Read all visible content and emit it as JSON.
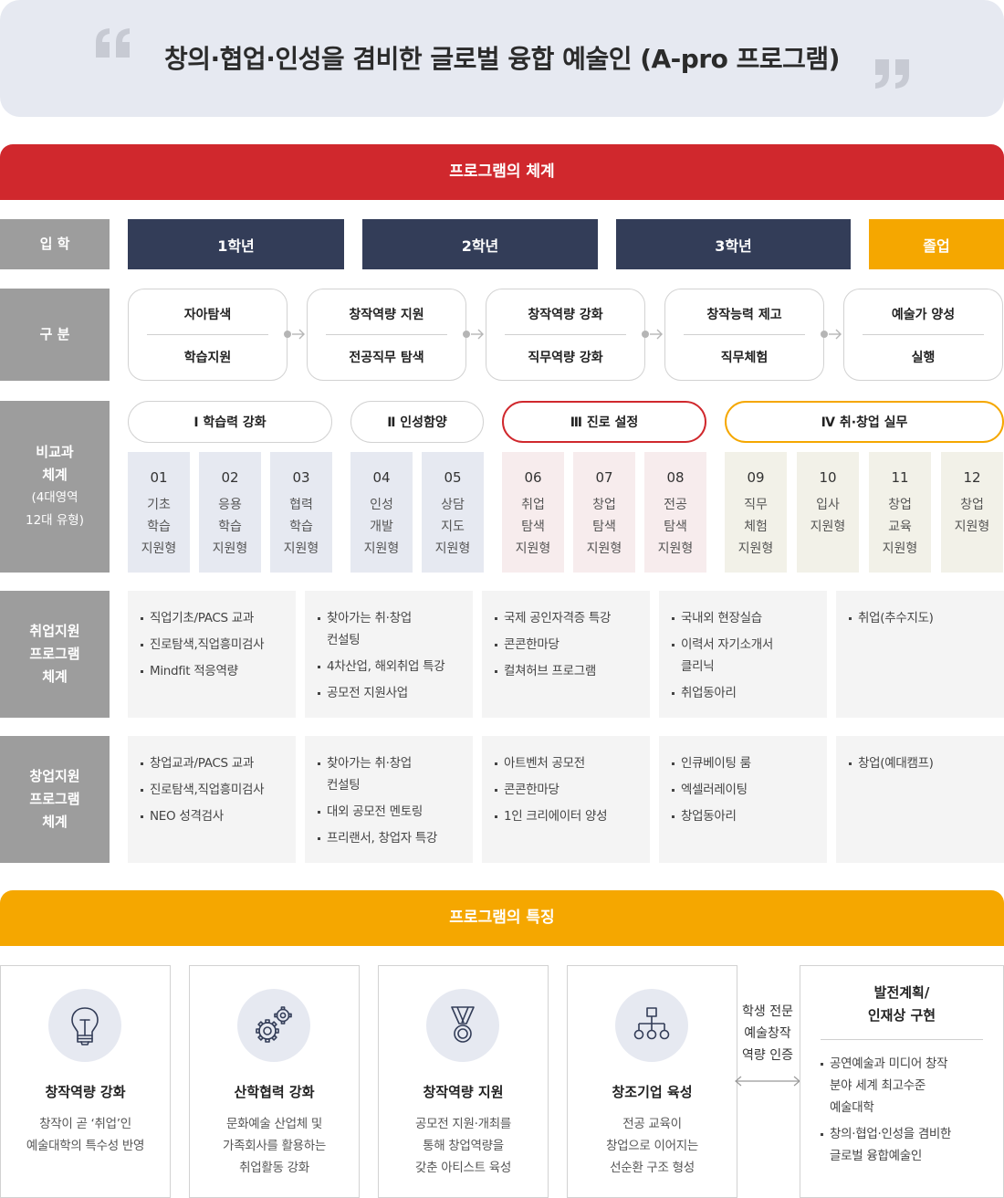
{
  "title": "창의·협업·인성을 겸비한 글로벌 융합 예술인 (A-pro 프로그램)",
  "section_system": "프로그램의 체계",
  "section_features": "프로그램의 특징",
  "row_labels": {
    "admission": "입  학",
    "category": "구  분",
    "non_curricular": "비교과\n체계",
    "non_curricular_sub": "(4대영역\n12대 유형)",
    "employment": "취업지원\n프로그램\n체계",
    "startup": "창업지원\n프로그램\n체계"
  },
  "years": [
    "1학년",
    "2학년",
    "3학년",
    "졸업"
  ],
  "stages": [
    {
      "top": "자아탐색",
      "bottom": "학습지원"
    },
    {
      "top": "창작역량 지원",
      "bottom": "전공직무 탐색"
    },
    {
      "top": "창작역량 강화",
      "bottom": "직무역량 강화"
    },
    {
      "top": "창작능력 제고",
      "bottom": "직무체험"
    },
    {
      "top": "예술가 양성",
      "bottom": "실행"
    }
  ],
  "areas": [
    "Ⅰ  학습력 강화",
    "Ⅱ 인성함양",
    "Ⅲ 진로 설정",
    "Ⅳ 취·창업 실무"
  ],
  "types": [
    {
      "num": "01",
      "name": "기초\n학습\n지원형"
    },
    {
      "num": "02",
      "name": "응용\n학습\n지원형"
    },
    {
      "num": "03",
      "name": "협력\n학습\n지원형"
    },
    {
      "num": "04",
      "name": "인성\n개발\n지원형"
    },
    {
      "num": "05",
      "name": "상담\n지도\n지원형"
    },
    {
      "num": "06",
      "name": "취업\n탐색\n지원형"
    },
    {
      "num": "07",
      "name": "창업\n탐색\n지원형"
    },
    {
      "num": "08",
      "name": "전공\n탐색\n지원형"
    },
    {
      "num": "09",
      "name": "직무\n체험\n지원형"
    },
    {
      "num": "10",
      "name": "입사\n지원형"
    },
    {
      "num": "11",
      "name": "창업\n교육\n지원형"
    },
    {
      "num": "12",
      "name": "창업\n지원형"
    }
  ],
  "employment": [
    [
      "직업기초/PACS 교과",
      "진로탐색,직업흥미검사",
      "Mindfit 적응역량"
    ],
    [
      "찾아가는 취·창업\n컨설팅",
      "4차산업, 해외취업 특강",
      "공모전 지원사업"
    ],
    [
      "국제 공인자격증 특강",
      "콘콘한마당",
      "컬쳐허브 프로그램"
    ],
    [
      "국내외 현장실습",
      "이력서 자기소개서\n클리닉",
      "취업동아리"
    ],
    [
      "취업(추수지도)"
    ]
  ],
  "startup": [
    [
      "창업교과/PACS 교과",
      "진로탐색,직업흥미검사",
      "NEO 성격검사"
    ],
    [
      "찾아가는 취·창업\n컨설팅",
      "대외 공모전 멘토링",
      "프리랜서, 창업자 특강"
    ],
    [
      "아트벤처 공모전",
      "콘콘한마당",
      "1인 크리에이터 양성"
    ],
    [
      "인큐베이팅 룸",
      "엑셀러레이팅",
      "창업동아리"
    ],
    [
      "창업(예대캠프)"
    ]
  ],
  "features": [
    {
      "icon": "lightbulb-icon",
      "title": "창작역량 강화",
      "desc": "창작이 곧 ‘취업’인\n예술대학의 특수성 반영"
    },
    {
      "icon": "gears-icon",
      "title": "산학협력 강화",
      "desc": "문화예술 산업체 및\n가족회사를 활용하는\n취업활동 강화"
    },
    {
      "icon": "medal-icon",
      "title": "창작역량 지원",
      "desc": "공모전 지원·개최를\n통해 창업역량을\n갖춘 아티스트 육성"
    },
    {
      "icon": "org-chart-icon",
      "title": "창조기업 육성",
      "desc": "전공 교육이\n창업으로 이어지는\n선순환 구조 형성"
    }
  ],
  "certification": "학생 전문\n예술창작\n역량 인증",
  "plan": {
    "title": "발전계획/\n인재상 구현",
    "items": [
      "공연예술과 미디어 창작\n분야 세계 최고수준\n예술대학",
      "창의·협업·인성을 겸비한\n글로벌 융합예술인"
    ]
  },
  "colors": {
    "system_bar": "#d0282d",
    "feature_bar": "#f5a700",
    "year_box": "#333d58",
    "graduation_box": "#f5a700",
    "label_gray": "#9d9d9d",
    "area1_fill": "#e6e9f1",
    "area3_fill": "#f7eced",
    "area4_fill": "#f2f1e8",
    "area3_border": "#d0282d",
    "area4_border": "#f5a700",
    "support_bg": "#f4f4f4"
  }
}
